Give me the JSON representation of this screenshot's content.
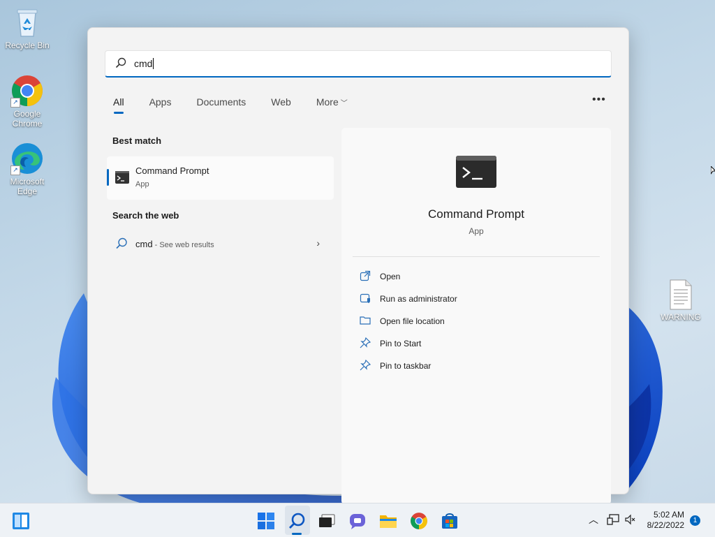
{
  "desktop": {
    "icons": [
      {
        "label": "Recycle Bin",
        "icon": "recycle-bin-icon"
      },
      {
        "label": "Google Chrome",
        "icon": "chrome-icon"
      },
      {
        "label": "Microsoft Edge",
        "icon": "edge-icon"
      }
    ],
    "file": {
      "label": "WARNING",
      "icon": "text-file-icon"
    }
  },
  "search": {
    "query": "cmd",
    "tabs": [
      "All",
      "Apps",
      "Documents",
      "Web",
      "More"
    ],
    "active_tab": "All",
    "more_icon": "chevron-down-icon",
    "options_icon": "ellipsis-icon",
    "best_match": {
      "heading": "Best match",
      "title": "Command Prompt",
      "subtitle": "App",
      "icon": "terminal-icon"
    },
    "web": {
      "heading": "Search the web",
      "query": "cmd",
      "suffix": " - See web results",
      "icon": "search-icon"
    },
    "detail": {
      "title": "Command Prompt",
      "subtitle": "App",
      "actions": [
        {
          "label": "Open",
          "icon": "open-external-icon"
        },
        {
          "label": "Run as administrator",
          "icon": "shield-icon"
        },
        {
          "label": "Open file location",
          "icon": "folder-icon"
        },
        {
          "label": "Pin to Start",
          "icon": "pin-icon"
        },
        {
          "label": "Pin to taskbar",
          "icon": "pin-icon"
        }
      ]
    }
  },
  "taskbar": {
    "apps": [
      "start-icon",
      "search-icon",
      "task-view-icon",
      "chat-icon",
      "file-explorer-icon",
      "chrome-icon",
      "store-icon"
    ],
    "time": "5:02 AM",
    "date": "8/22/2022",
    "notification_count": "1"
  },
  "colors": {
    "accent": "#0067c0",
    "panel": "#f3f3f3",
    "taskbar": "#eef2f6"
  }
}
